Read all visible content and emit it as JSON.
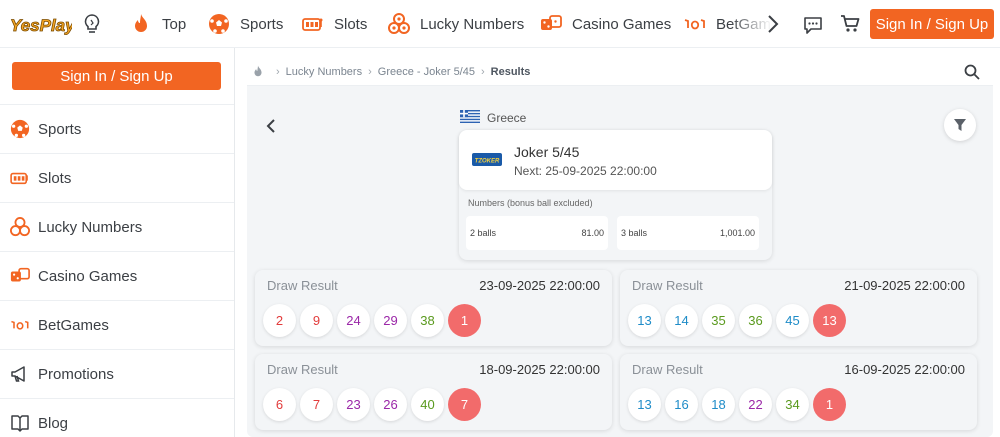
{
  "brand": {
    "logo_text": "YesPlay",
    "accent": "#f26522",
    "bonus_ball_color": "#f26b6b"
  },
  "topnav": {
    "items": [
      {
        "label": "Top",
        "icon": "flame-icon"
      },
      {
        "label": "Sports",
        "icon": "soccer-ball-icon"
      },
      {
        "label": "Slots",
        "icon": "slot-machine-icon"
      },
      {
        "label": "Lucky Numbers",
        "icon": "lottery-balls-icon"
      },
      {
        "label": "Casino Games",
        "icon": "dice-icon"
      },
      {
        "label": "BetGames",
        "icon": "betgames-icon"
      }
    ],
    "signin_label": "Sign In / Sign Up"
  },
  "sidebar": {
    "signin_label": "Sign In / Sign Up",
    "items": [
      {
        "label": "Sports",
        "icon": "soccer-ball-icon"
      },
      {
        "label": "Slots",
        "icon": "slot-machine-icon"
      },
      {
        "label": "Lucky Numbers",
        "icon": "lottery-balls-icon"
      },
      {
        "label": "Casino Games",
        "icon": "dice-icon"
      },
      {
        "label": "BetGames",
        "icon": "betgames-icon"
      },
      {
        "label": "Promotions",
        "icon": "megaphone-icon"
      },
      {
        "label": "Blog",
        "icon": "blog-icon"
      }
    ]
  },
  "breadcrumb": [
    "Lucky Numbers",
    "Greece - Joker 5/45",
    "Results"
  ],
  "game": {
    "country": "Greece",
    "logo_text": "TZOKER",
    "name": "Joker 5/45",
    "next": "Next: 25-09-2025 22:00:00",
    "numbers_label": "Numbers (bonus ball excluded)",
    "odds": [
      {
        "label": "2 balls",
        "value": "81.00"
      },
      {
        "label": "3 balls",
        "value": "1,001.00"
      }
    ]
  },
  "results": {
    "label": "Draw Result",
    "draws": [
      {
        "date": "23-09-2025 22:00:00",
        "numbers": [
          "2",
          "9",
          "24",
          "29",
          "38"
        ],
        "bonus": "1"
      },
      {
        "date": "21-09-2025 22:00:00",
        "numbers": [
          "13",
          "14",
          "35",
          "36",
          "45"
        ],
        "bonus": "13"
      },
      {
        "date": "18-09-2025 22:00:00",
        "numbers": [
          "6",
          "7",
          "23",
          "26",
          "40"
        ],
        "bonus": "7"
      },
      {
        "date": "16-09-2025 22:00:00",
        "numbers": [
          "13",
          "16",
          "18",
          "22",
          "34"
        ],
        "bonus": "1"
      }
    ]
  }
}
